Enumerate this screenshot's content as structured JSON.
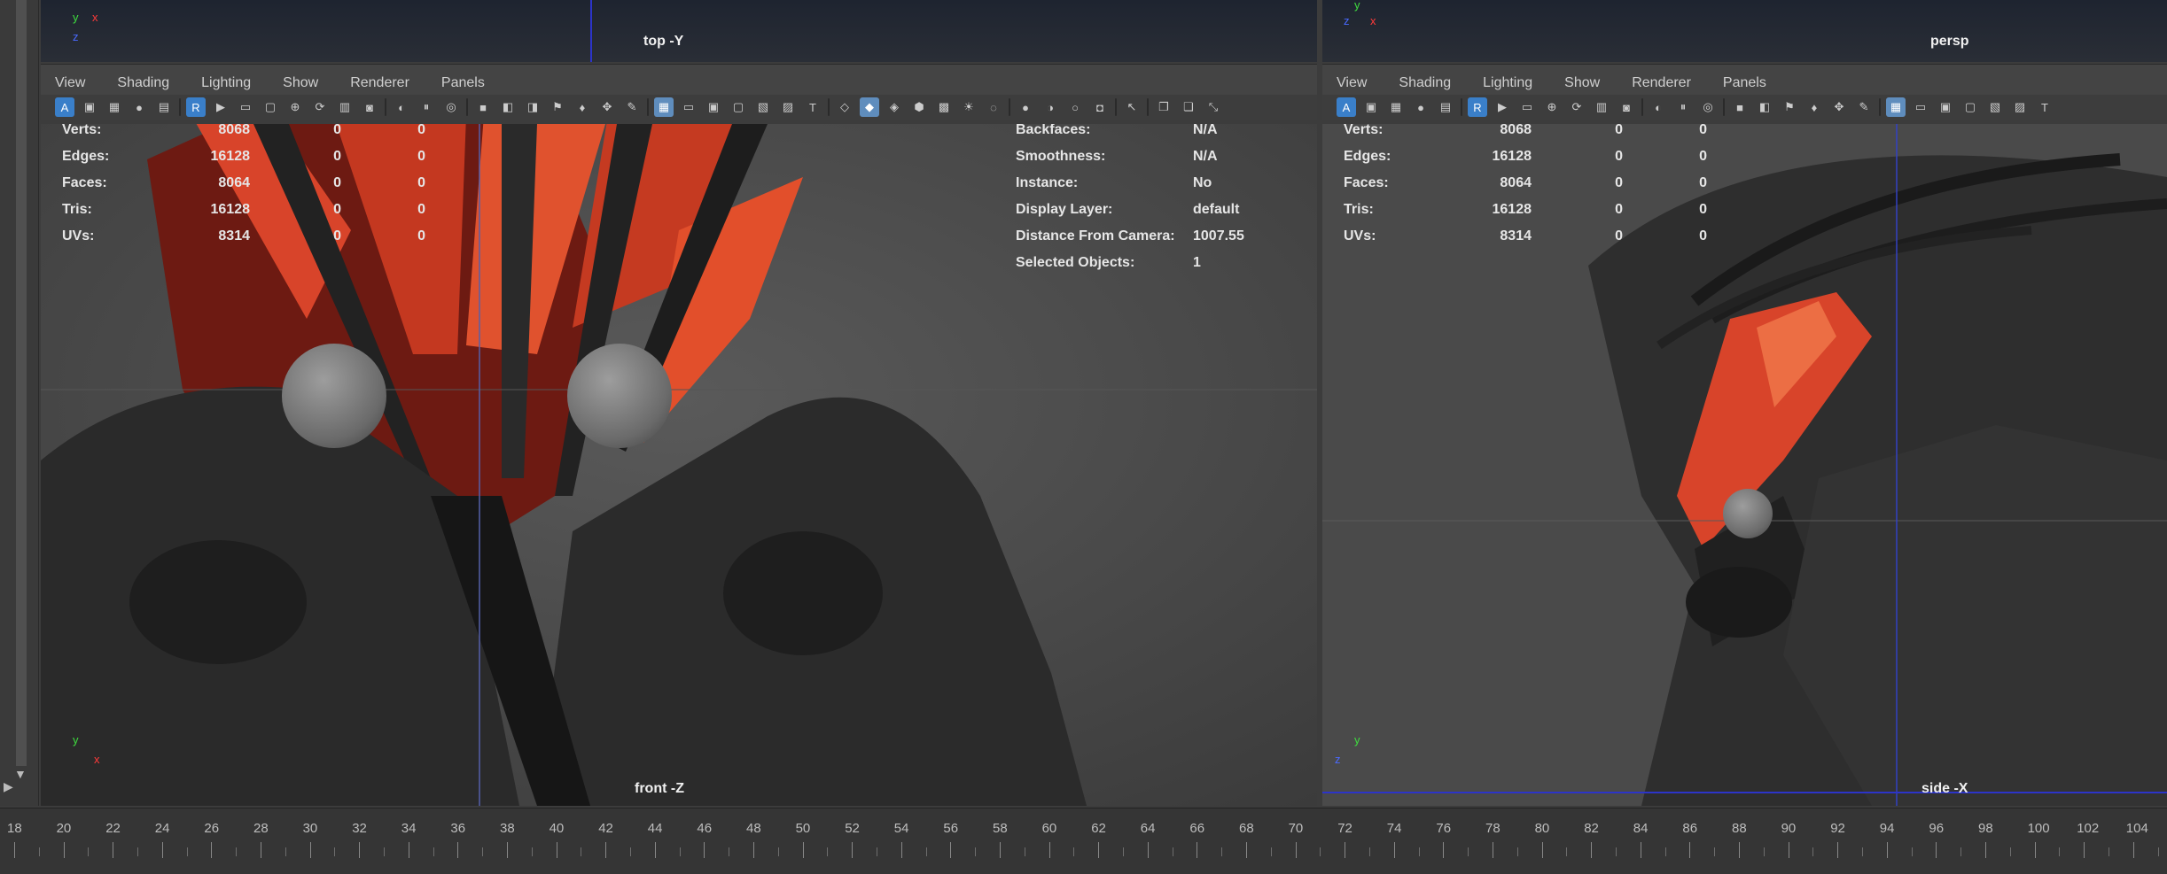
{
  "viewports": {
    "top": {
      "label": "top -Y",
      "axis_y": "y",
      "axis_x": "x",
      "axis_z": "z"
    },
    "persp": {
      "label": "persp",
      "axis_y": "y",
      "axis_x": "x",
      "axis_z": "z"
    },
    "front": {
      "label": "front -Z",
      "axis_y": "y",
      "axis_x": "x"
    },
    "side": {
      "label": "side -X",
      "axis_y": "y",
      "axis_z": "z"
    }
  },
  "menu": [
    "View",
    "Shading",
    "Lighting",
    "Show",
    "Renderer",
    "Panels"
  ],
  "hud_stats": [
    {
      "label": "Verts:",
      "val": "8068",
      "a": "0",
      "b": "0"
    },
    {
      "label": "Edges:",
      "val": "16128",
      "a": "0",
      "b": "0"
    },
    {
      "label": "Faces:",
      "val": "8064",
      "a": "0",
      "b": "0"
    },
    {
      "label": "Tris:",
      "val": "16128",
      "a": "0",
      "b": "0"
    },
    {
      "label": "UVs:",
      "val": "8314",
      "a": "0",
      "b": "0"
    }
  ],
  "hud_info": [
    {
      "label": "Backfaces:",
      "val": "N/A"
    },
    {
      "label": "Smoothness:",
      "val": "N/A"
    },
    {
      "label": "Instance:",
      "val": "No"
    },
    {
      "label": "Display Layer:",
      "val": "default"
    },
    {
      "label": "Distance From Camera:",
      "val": "1007.55"
    },
    {
      "label": "Selected Objects:",
      "val": "1"
    }
  ],
  "timeline_ticks": [
    "18",
    "20",
    "22",
    "24",
    "26",
    "28",
    "30",
    "32",
    "34",
    "36",
    "38",
    "40",
    "42",
    "44",
    "46",
    "48",
    "50",
    "52",
    "54",
    "56",
    "58",
    "60",
    "62",
    "64",
    "66",
    "68",
    "70",
    "72",
    "74",
    "76",
    "78",
    "80",
    "82",
    "84",
    "86",
    "88",
    "90",
    "92",
    "94",
    "96",
    "98",
    "100",
    "102",
    "104"
  ],
  "colors": {
    "axis_x": "#ff3a3a",
    "axis_y": "#3fdc3f",
    "axis_z": "#4a6aff",
    "helmet_red": "#d8442a"
  }
}
